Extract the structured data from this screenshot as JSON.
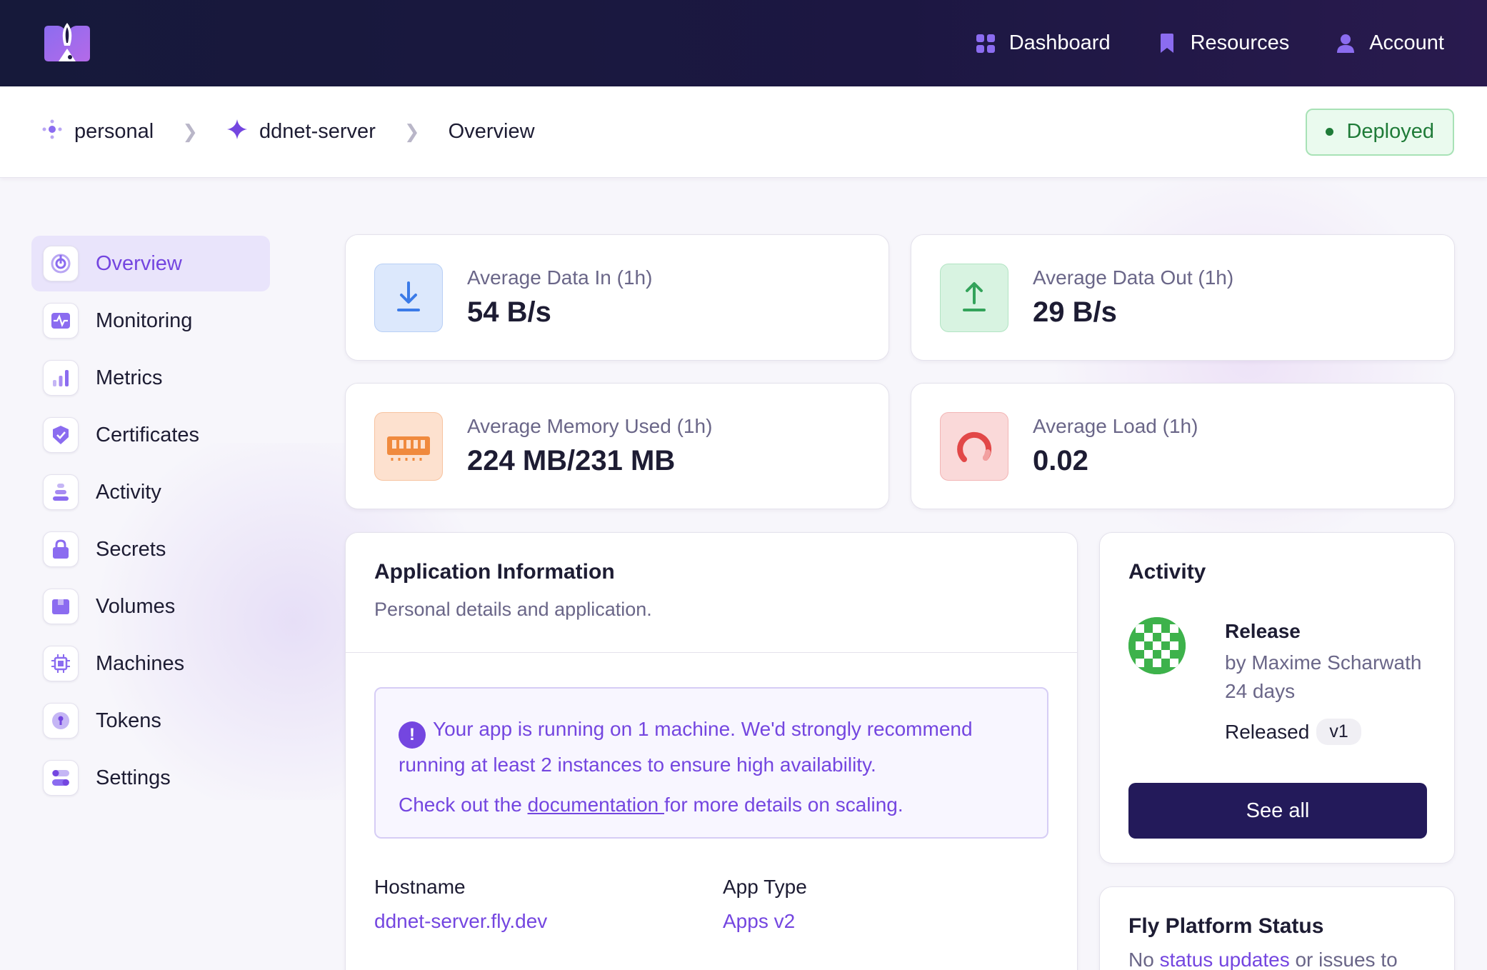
{
  "nav": {
    "items": [
      {
        "label": "Dashboard",
        "icon": "grid-icon"
      },
      {
        "label": "Resources",
        "icon": "bookmark-icon"
      },
      {
        "label": "Account",
        "icon": "user-icon"
      }
    ]
  },
  "breadcrumb": {
    "org": "personal",
    "app": "ddnet-server",
    "page": "Overview"
  },
  "status_badge": {
    "label": "Deployed",
    "color": "#1f7b38"
  },
  "sidebar": {
    "items": [
      {
        "label": "Overview",
        "active": true,
        "icon": "overview-icon"
      },
      {
        "label": "Monitoring",
        "icon": "pulse-icon"
      },
      {
        "label": "Metrics",
        "icon": "bar-chart-icon"
      },
      {
        "label": "Certificates",
        "icon": "certificate-icon"
      },
      {
        "label": "Activity",
        "icon": "stack-icon"
      },
      {
        "label": "Secrets",
        "icon": "lock-icon"
      },
      {
        "label": "Volumes",
        "icon": "volume-icon"
      },
      {
        "label": "Machines",
        "icon": "chip-icon"
      },
      {
        "label": "Tokens",
        "icon": "token-icon"
      },
      {
        "label": "Settings",
        "icon": "toggle-icon"
      }
    ]
  },
  "stats": {
    "data_in": {
      "label": "Average Data In (1h)",
      "value": "54 B/s"
    },
    "data_out": {
      "label": "Average Data Out (1h)",
      "value": "29 B/s"
    },
    "memory": {
      "label": "Average Memory Used (1h)",
      "value": "224 MB/231 MB"
    },
    "load": {
      "label": "Average Load (1h)",
      "value": "0.02"
    }
  },
  "app_info": {
    "title": "Application Information",
    "subtitle": "Personal details and application.",
    "notice_line1": "Your app is running on 1 machine. We'd strongly recommend running at least 2 instances to ensure high availability.",
    "notice_pre": "Check out the ",
    "notice_link": "documentation ",
    "notice_post": "for more details on scaling.",
    "hostname_label": "Hostname",
    "hostname_value": "ddnet-server.fly.dev",
    "apptype_label": "App Type",
    "apptype_value": "Apps v2"
  },
  "activity": {
    "title": "Activity",
    "release_title": "Release",
    "release_by": "by Maxime Scharwath 24 days",
    "released_label": "Released",
    "version": "v1",
    "see_all": "See all"
  },
  "platform_status": {
    "title": "Fly Platform Status",
    "pre": "No ",
    "link": "status updates",
    "post": " or issues to"
  },
  "colors": {
    "accent": "#7446e0",
    "topbar": "#16193a",
    "button": "#231a5a"
  }
}
